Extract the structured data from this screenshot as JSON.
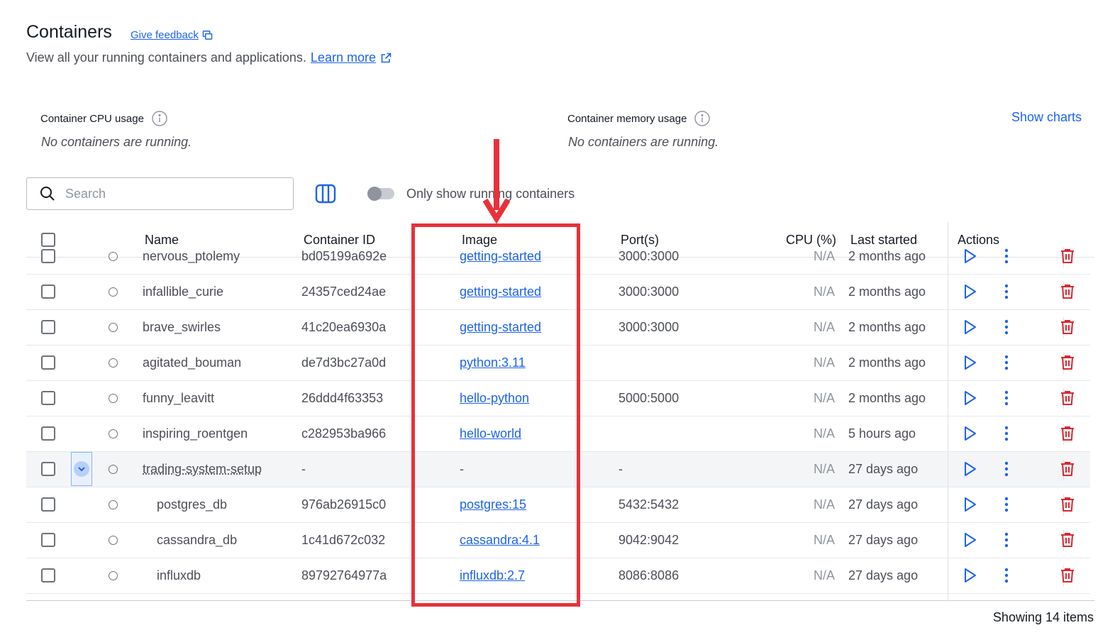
{
  "page": {
    "title": "Containers",
    "feedback_label": "Give feedback",
    "subtitle": "View all your running containers and applications.",
    "learn_more_label": "Learn more"
  },
  "metrics": {
    "cpu_label": "Container CPU usage",
    "cpu_empty": "No containers are running.",
    "memory_label": "Container memory usage",
    "memory_empty": "No containers are running.",
    "show_charts_label": "Show charts"
  },
  "toolbar": {
    "search_placeholder": "Search",
    "toggle_label": "Only show running containers",
    "toggle_on": false
  },
  "table": {
    "headers": {
      "name": "Name",
      "container_id": "Container ID",
      "image": "Image",
      "ports": "Port(s)",
      "cpu": "CPU (%)",
      "last_started": "Last started",
      "actions": "Actions"
    },
    "rows": [
      {
        "name": "nervous_ptolemy",
        "id": "bd05199a692e",
        "image": "getting-started",
        "ports": "3000:3000",
        "cpu": "N/A",
        "last_started": "2 months ago",
        "indent": false,
        "group": false
      },
      {
        "name": "infallible_curie",
        "id": "24357ced24ae",
        "image": "getting-started",
        "ports": "3000:3000",
        "cpu": "N/A",
        "last_started": "2 months ago",
        "indent": false,
        "group": false
      },
      {
        "name": "brave_swirles",
        "id": "41c20ea6930a",
        "image": "getting-started",
        "ports": "3000:3000",
        "cpu": "N/A",
        "last_started": "2 months ago",
        "indent": false,
        "group": false
      },
      {
        "name": "agitated_bouman",
        "id": "de7d3bc27a0d",
        "image": "python:3.11",
        "ports": "",
        "cpu": "N/A",
        "last_started": "2 months ago",
        "indent": false,
        "group": false
      },
      {
        "name": "funny_leavitt",
        "id": "26ddd4f63353",
        "image": "hello-python",
        "ports": "5000:5000",
        "cpu": "N/A",
        "last_started": "2 months ago",
        "indent": false,
        "group": false
      },
      {
        "name": "inspiring_roentgen",
        "id": "c282953ba966",
        "image": "hello-world",
        "ports": "",
        "cpu": "N/A",
        "last_started": "5 hours ago",
        "indent": false,
        "group": false
      },
      {
        "name": "trading-system-setup",
        "id": "-",
        "image": "-",
        "ports": "-",
        "cpu": "N/A",
        "last_started": "27 days ago",
        "indent": false,
        "group": true
      },
      {
        "name": "postgres_db",
        "id": "976ab26915c0",
        "image": "postgres:15",
        "ports": "5432:5432",
        "cpu": "N/A",
        "last_started": "27 days ago",
        "indent": true,
        "group": false
      },
      {
        "name": "cassandra_db",
        "id": "1c41d672c032",
        "image": "cassandra:4.1",
        "ports": "9042:9042",
        "cpu": "N/A",
        "last_started": "27 days ago",
        "indent": true,
        "group": false
      },
      {
        "name": "influxdb",
        "id": "89792764977a",
        "image": "influxdb:2.7",
        "ports": "8086:8086",
        "cpu": "N/A",
        "last_started": "27 days ago",
        "indent": true,
        "group": false
      }
    ]
  },
  "footer": {
    "count_label": "Showing 14 items"
  },
  "colors": {
    "accent": "#1d63ed",
    "danger": "#d9282f",
    "annotation": "#e8313a"
  },
  "icons": [
    "feedback-icon",
    "external-link-icon",
    "info-icon",
    "search-icon",
    "columns-icon",
    "play-icon",
    "more-vertical-icon",
    "trash-icon",
    "chevron-down-icon"
  ]
}
